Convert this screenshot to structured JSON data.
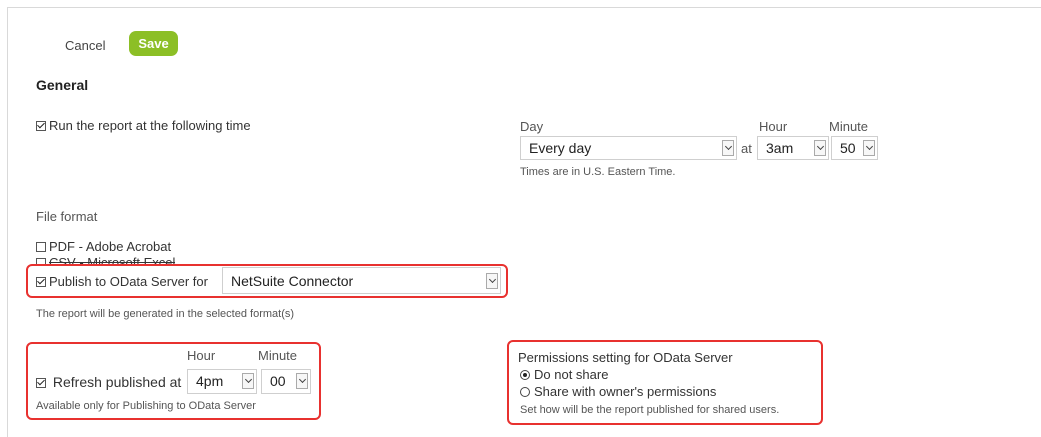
{
  "toolbar": {
    "cancel_label": "Cancel",
    "save_label": "Save"
  },
  "section_title": "General",
  "schedule": {
    "run_label": "Run the report at the following time",
    "run_checked": true,
    "day_label": "Day",
    "hour_label": "Hour",
    "minute_label": "Minute",
    "day_value": "Every day",
    "at_label": "at",
    "hour_value": "3am",
    "minute_value": "50",
    "timezone_note": "Times are in U.S. Eastern Time."
  },
  "file_format": {
    "label": "File format",
    "options": [
      {
        "label": "PDF - Adobe Acrobat",
        "checked": false
      },
      {
        "label": "CSV - Microsoft Excel",
        "checked": false
      },
      {
        "label": "Publish to OData Server for",
        "checked": true
      }
    ],
    "odata_target": "NetSuite Connector",
    "note": "The report will be generated in the selected format(s)"
  },
  "refresh": {
    "hour_label": "Hour",
    "minute_label": "Minute",
    "label": "Refresh published at",
    "checked": true,
    "hour_value": "4pm",
    "minute_value": "00",
    "note": "Available only for Publishing to OData Server"
  },
  "permissions": {
    "title": "Permissions setting for OData Server",
    "options": [
      {
        "label": "Do not share",
        "selected": true
      },
      {
        "label": "Share with owner's permissions",
        "selected": false
      }
    ],
    "note": "Set how will be the report published for shared users."
  },
  "colors": {
    "save_button": "#8cbf26",
    "highlight": "#e8312f"
  }
}
